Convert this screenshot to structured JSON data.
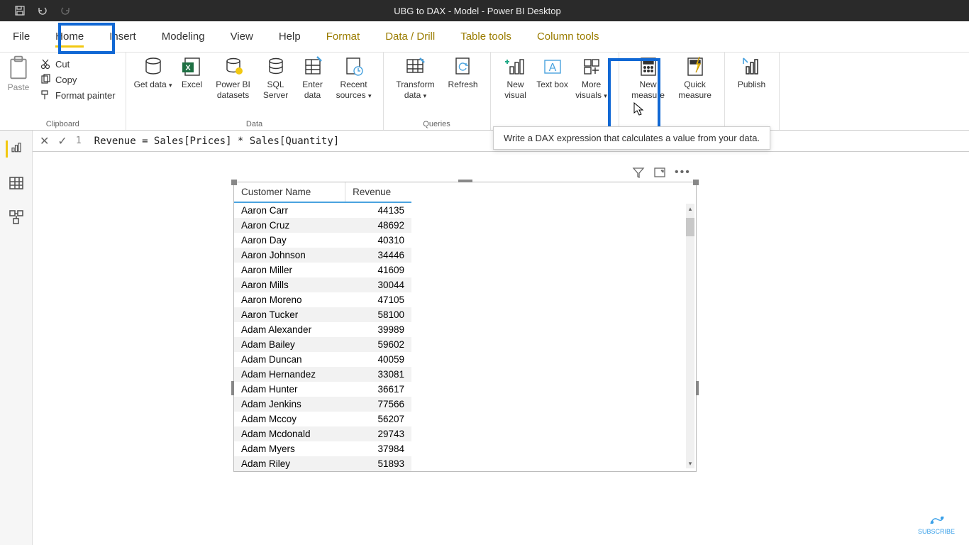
{
  "app_title": "UBG to DAX - Model - Power BI Desktop",
  "menubar": [
    "File",
    "Home",
    "Insert",
    "Modeling",
    "View",
    "Help",
    "Format",
    "Data / Drill",
    "Table tools",
    "Column tools"
  ],
  "ribbon": {
    "paste": "Paste",
    "clipboard": {
      "cut": "Cut",
      "copy": "Copy",
      "format_painter": "Format painter",
      "group": "Clipboard"
    },
    "data": {
      "get_data": "Get data",
      "excel": "Excel",
      "pbi_datasets": "Power BI datasets",
      "sql_server": "SQL Server",
      "enter_data": "Enter data",
      "recent_sources": "Recent sources",
      "group": "Data"
    },
    "queries": {
      "transform_data": "Transform data",
      "refresh": "Refresh",
      "group": "Queries"
    },
    "insert": {
      "new_visual": "New visual",
      "text_box": "Text box",
      "more_visuals": "More visuals"
    },
    "calc": {
      "new_measure": "New measure",
      "quick_measure": "Quick measure"
    },
    "share": {
      "publish": "Publish"
    }
  },
  "tooltip": "Write a DAX expression that calculates a value from your data.",
  "formula": {
    "line": "1",
    "text": "Revenue = Sales[Prices] * Sales[Quantity]"
  },
  "table": {
    "headers": [
      "Customer Name",
      "Revenue"
    ],
    "rows": [
      [
        "Aaron Carr",
        "44135"
      ],
      [
        "Aaron Cruz",
        "48692"
      ],
      [
        "Aaron Day",
        "40310"
      ],
      [
        "Aaron Johnson",
        "34446"
      ],
      [
        "Aaron Miller",
        "41609"
      ],
      [
        "Aaron Mills",
        "30044"
      ],
      [
        "Aaron Moreno",
        "47105"
      ],
      [
        "Aaron Tucker",
        "58100"
      ],
      [
        "Adam Alexander",
        "39989"
      ],
      [
        "Adam Bailey",
        "59602"
      ],
      [
        "Adam Duncan",
        "40059"
      ],
      [
        "Adam Hernandez",
        "33081"
      ],
      [
        "Adam Hunter",
        "36617"
      ],
      [
        "Adam Jenkins",
        "77566"
      ],
      [
        "Adam Mccoy",
        "56207"
      ],
      [
        "Adam Mcdonald",
        "29743"
      ],
      [
        "Adam Myers",
        "37984"
      ],
      [
        "Adam Riley",
        "51893"
      ]
    ]
  },
  "subscribe": "SUBSCRIBE"
}
